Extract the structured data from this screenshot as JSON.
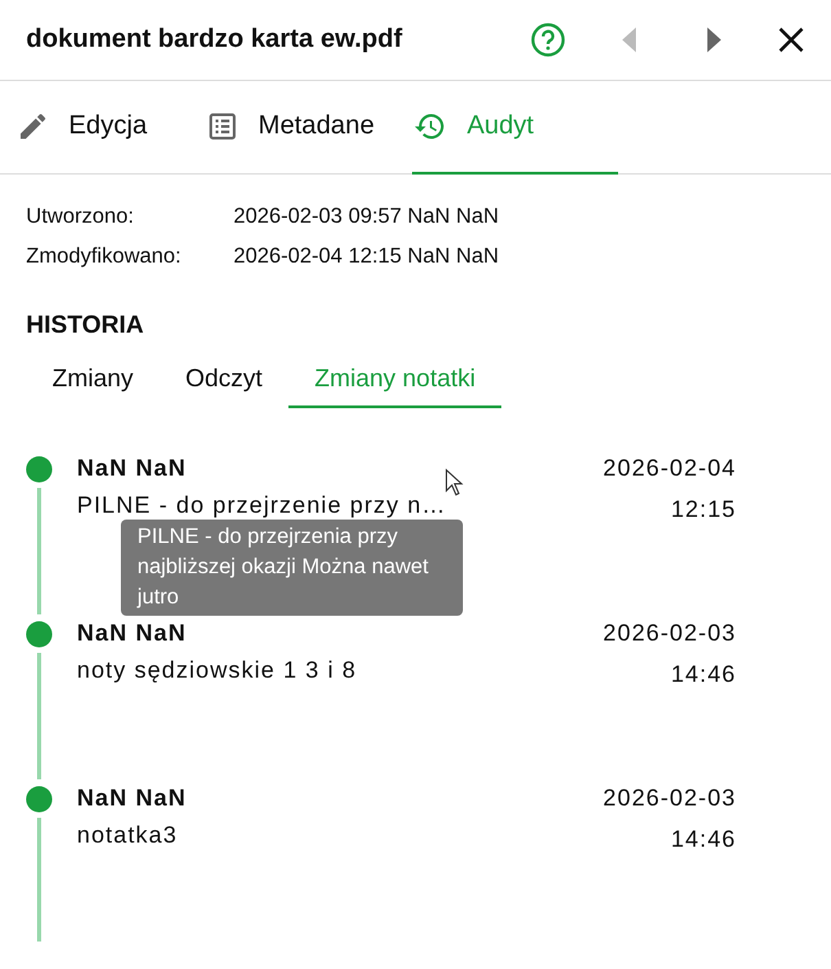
{
  "header": {
    "title": "dokument bardzo karta ew.pdf",
    "prev_disabled": true,
    "next_disabled": false
  },
  "tabs": [
    {
      "label": "Edycja",
      "kind": "edit",
      "selected": false
    },
    {
      "label": "Metadane",
      "kind": "metadata",
      "selected": false
    },
    {
      "label": "Audyt",
      "kind": "audit",
      "selected": true
    }
  ],
  "meta": [
    {
      "label": "Utworzono:",
      "value": "2026-02-03 09:57 NaN NaN"
    },
    {
      "label": "Zmodyfikowano:",
      "value": "2026-02-04 12:15 NaN NaN"
    }
  ],
  "history": {
    "title": "HISTORIA",
    "tabs": [
      {
        "label": "Zmiany",
        "selected": false
      },
      {
        "label": "Odczyt",
        "selected": false
      },
      {
        "label": "Zmiany notatki",
        "selected": true
      }
    ],
    "entries": [
      {
        "author": "NaN NaN",
        "note": "PILNE - do przejrzenie przy n…",
        "date": "2026-02-04",
        "time": "12:15",
        "tooltip": "PILNE - do przejrzenia przy najbliższej okazji Można nawet jutro"
      },
      {
        "author": "NaN NaN",
        "note": "noty sędziowskie 1 3 i 8",
        "date": "2026-02-03",
        "time": "14:46"
      },
      {
        "author": "NaN NaN",
        "note": "notatka3",
        "date": "2026-02-03",
        "time": "14:46"
      }
    ]
  }
}
